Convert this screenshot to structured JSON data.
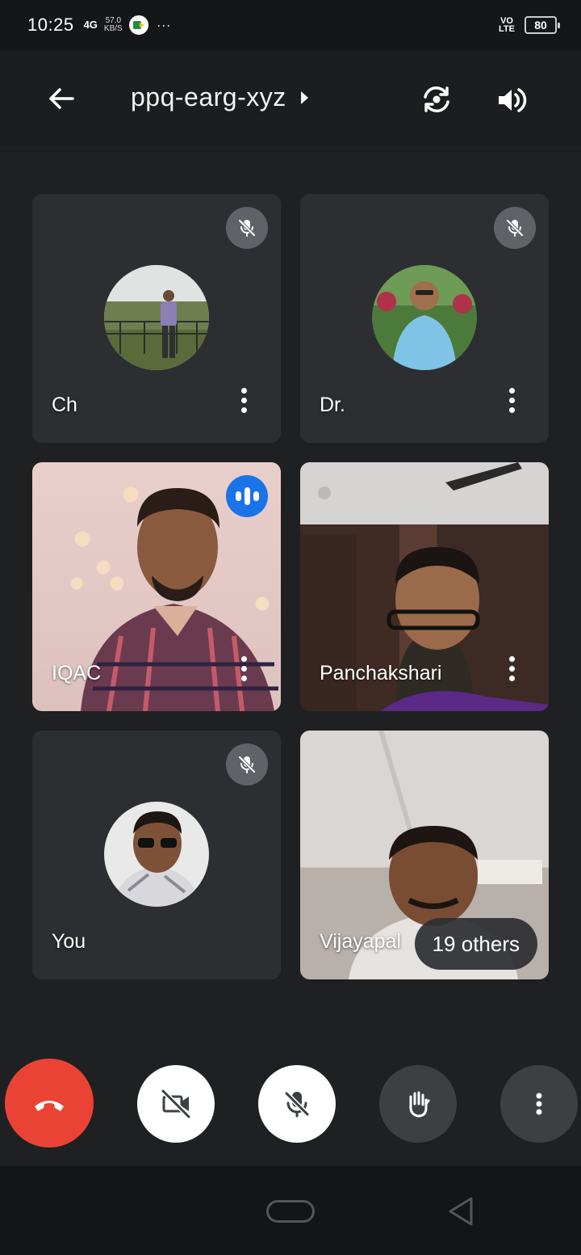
{
  "status_bar": {
    "time": "10:25",
    "signal": "4G",
    "speed_value": "57.0",
    "speed_unit": "KB/S",
    "more": "···",
    "volte": "VO\nLTE",
    "battery": "80"
  },
  "header": {
    "meeting_code": "ppq-earg-xyz"
  },
  "participants": [
    {
      "name": "Ch",
      "muted": true,
      "type": "avatar"
    },
    {
      "name": "Dr.",
      "muted": true,
      "type": "avatar"
    },
    {
      "name": "IQAC",
      "speaking": true,
      "type": "video"
    },
    {
      "name": "Panchakshari",
      "muted": false,
      "type": "video"
    },
    {
      "name": "You",
      "muted": true,
      "type": "avatar"
    },
    {
      "name": "Vijayapal",
      "type": "video"
    }
  ],
  "others_chip": "19 others",
  "colors": {
    "end_call": "#ea4335",
    "speaking_indicator": "#1a73e8",
    "tile_bg": "#2d2e31",
    "page_bg": "#1f2022"
  }
}
